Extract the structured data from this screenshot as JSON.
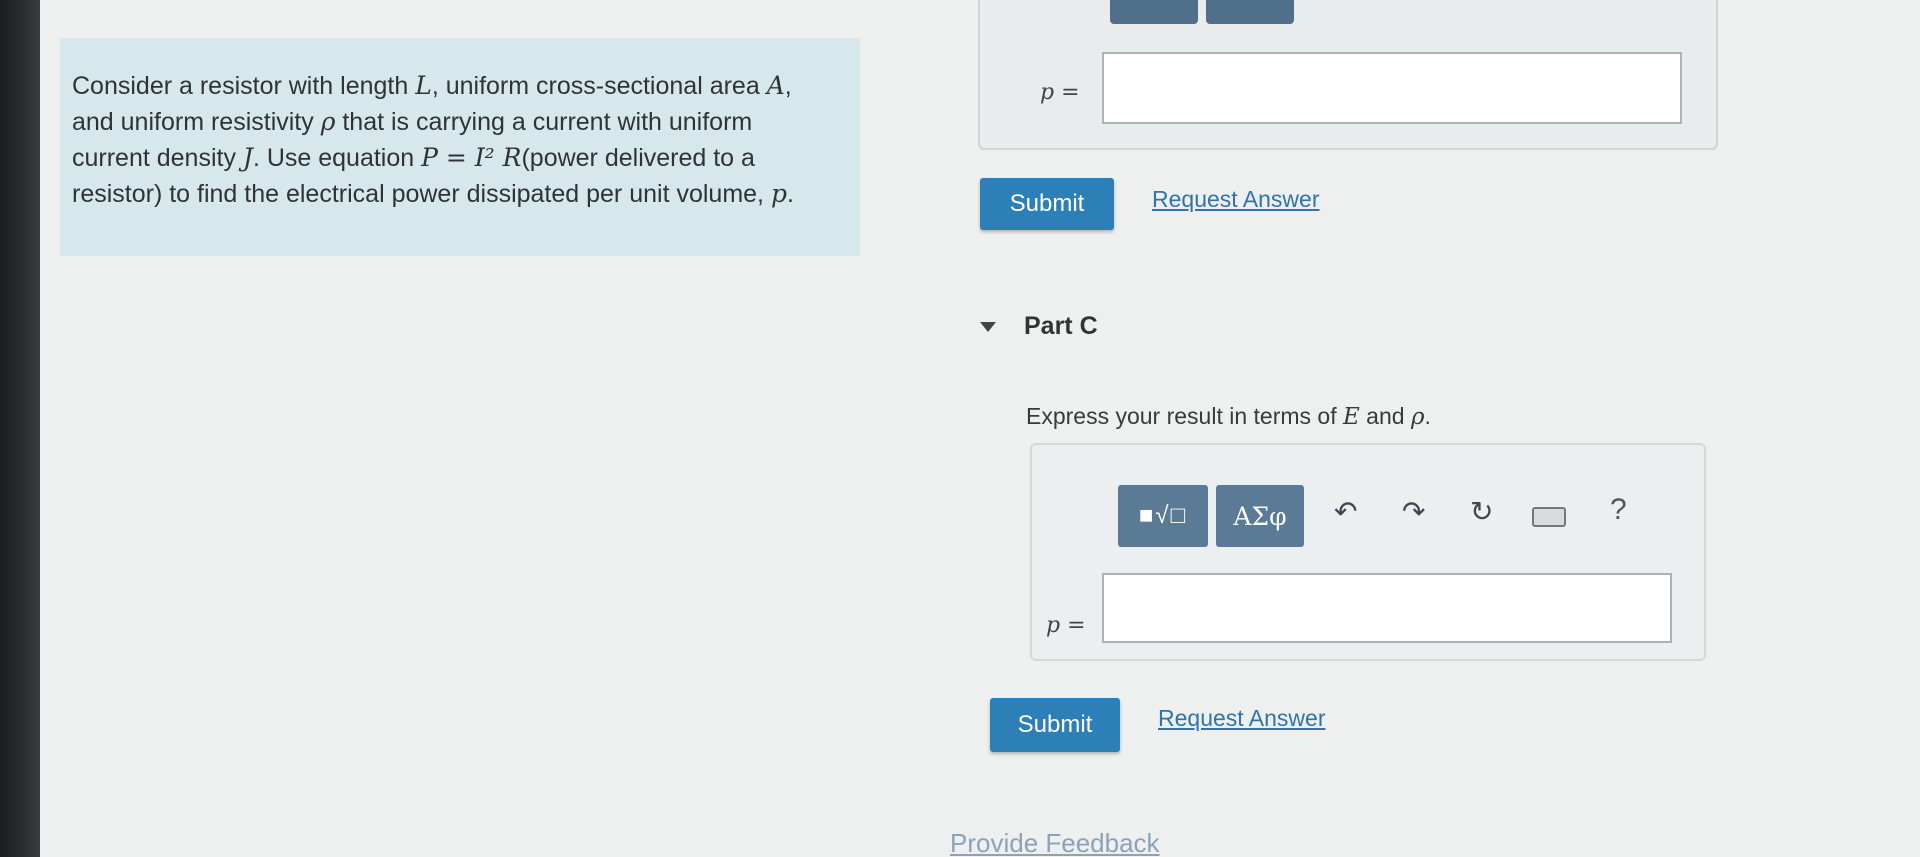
{
  "problem": {
    "text_parts": [
      "Consider a resistor with length ",
      "L",
      ", uniform cross-sectional area ",
      "A",
      ", and uniform resistivity ",
      "ρ",
      " that is carrying a current with uniform current density ",
      "J",
      ". Use equation ",
      "P = I² R",
      "(power delivered to a resistor) to find the electrical power dissipated per unit volume, ",
      "p",
      "."
    ]
  },
  "part_b": {
    "answer_label": "p =",
    "answer_value": "",
    "submit_label": "Submit",
    "request_answer_label": "Request Answer"
  },
  "part_c": {
    "title": "Part C",
    "instruction_prefix": "Express your result in terms of ",
    "var_e": "E",
    "instruction_and": " and ",
    "var_rho": "ρ",
    "instruction_suffix": ".",
    "toolbar": {
      "templates_label": "■√□",
      "greek_label": "ΑΣφ",
      "undo_icon": "↶",
      "redo_icon": "↷",
      "reset_icon": "↻",
      "help_label": "?"
    },
    "answer_label": "p =",
    "answer_value": "",
    "submit_label": "Submit",
    "request_answer_label": "Request Answer"
  },
  "footer": {
    "feedback_label": "Provide Feedback"
  },
  "colors": {
    "problem_bg": "#d7e8ed",
    "button_blue": "#2d7fb8",
    "toolbar_btn": "#5a7a96",
    "link": "#2f74ac"
  }
}
